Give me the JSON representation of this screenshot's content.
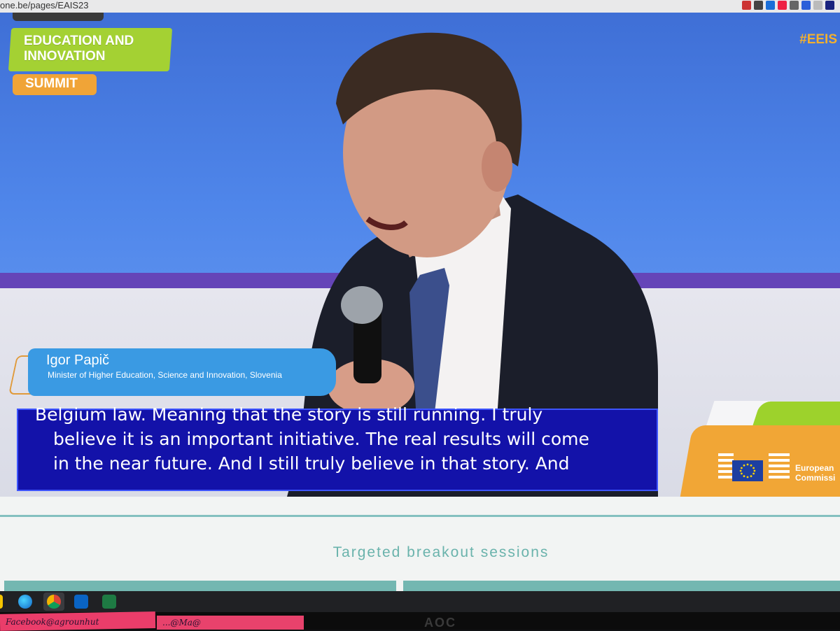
{
  "browser": {
    "url": "one.be/pages/EAIS23"
  },
  "event_logo": {
    "line_green": "EDUCATION AND\nINNOVATION",
    "line_orange": "SUMMIT"
  },
  "hashtag": "#EEIS",
  "lower_third": {
    "name": "Igor Papič",
    "role": "Minister of Higher Education, Science and Innovation, Slovenia"
  },
  "subtitles": [
    "Belgium law. Meaning that the story is still running. I truly",
    "believe it is an important initiative. The real results will come",
    "in the near future. And I still truly believe in that story. And"
  ],
  "ec_logo": {
    "text": "European\nCommissi"
  },
  "page": {
    "section_title": "Targeted breakout sessions"
  },
  "taskbar": {
    "icons": [
      "edge-icon",
      "chrome-icon",
      "outlook-icon",
      "excel-icon"
    ]
  },
  "monitor": {
    "brand": "AOC"
  },
  "sticky_notes": {
    "note1": "Facebook@agrounhut",
    "note2": "...@Ma@"
  },
  "colors": {
    "subtitle_bg": "#1312a9",
    "nameplate": "#3a9ae3",
    "accent_green": "#a4d133",
    "accent_orange": "#f0a437",
    "section_teal": "#6ab3ac"
  }
}
